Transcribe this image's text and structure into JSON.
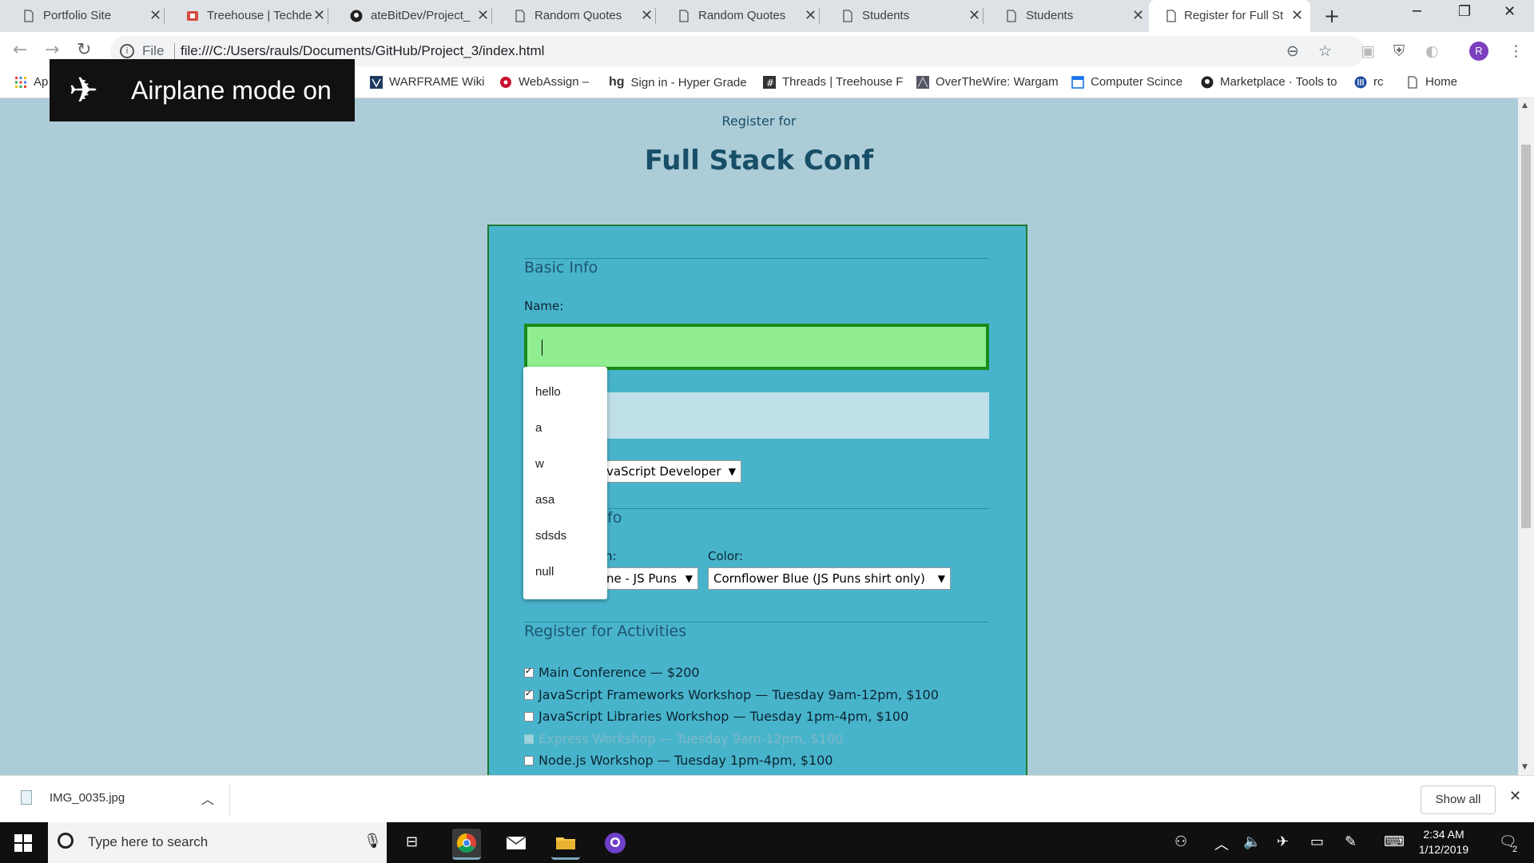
{
  "tabs": [
    {
      "label": "Portfolio Site",
      "icon": "page-icon"
    },
    {
      "label": "Treehouse | Techde",
      "icon": "treehouse-icon"
    },
    {
      "label": "ateBitDev/Project_",
      "icon": "github-icon"
    },
    {
      "label": "Random Quotes",
      "icon": "page-icon"
    },
    {
      "label": "Random Quotes",
      "icon": "page-icon"
    },
    {
      "label": "Students",
      "icon": "page-icon"
    },
    {
      "label": "Students",
      "icon": "page-icon"
    },
    {
      "label": "Register for Full St",
      "icon": "page-icon",
      "active": true
    }
  ],
  "toolbar": {
    "scheme_label": "File",
    "url": "file:///C:/Users/rauls/Documents/GitHub/Project_3/index.html",
    "avatar_letter": "R"
  },
  "bookmarks": [
    {
      "label": "Ap",
      "icon": "apps-icon"
    },
    {
      "label": "WARFRAME Wiki",
      "icon": "warframe-icon"
    },
    {
      "label": "WebAssign –",
      "icon": "webassign-icon"
    },
    {
      "label": "Sign in - Hyper Grade",
      "icon": "hypergrade-icon"
    },
    {
      "label": "Threads | Treehouse F",
      "icon": "threads-icon"
    },
    {
      "label": "OverTheWire: Wargam",
      "icon": "overthewire-icon"
    },
    {
      "label": "Computer Scince",
      "icon": "doc-icon"
    },
    {
      "label": "Marketplace · Tools to",
      "icon": "github-icon"
    },
    {
      "label": "rc",
      "icon": "rc-icon"
    },
    {
      "label": "Home",
      "icon": "page-icon"
    }
  ],
  "toast": {
    "text": "Airplane mode on",
    "icon": "airplane-icon"
  },
  "page": {
    "subheading": "Register for",
    "heading": "Full Stack Conf",
    "basic_info_legend": "Basic Info",
    "name_label": "Name:",
    "name_value": "",
    "job_role_value": "vaScript Developer",
    "tshirt_legend_partial": "fo",
    "design_label_partial": "n:",
    "design_value": "ne - JS Puns",
    "color_label": "Color:",
    "color_value": "Cornflower Blue (JS Puns shirt only)",
    "activities_legend": "Register for Activities",
    "activities": [
      {
        "label": "Main Conference — $200",
        "checked": true,
        "disabled": false
      },
      {
        "label": "JavaScript Frameworks Workshop — Tuesday 9am-12pm, $100",
        "checked": true,
        "disabled": false
      },
      {
        "label": "JavaScript Libraries Workshop — Tuesday 1pm-4pm, $100",
        "checked": false,
        "disabled": false
      },
      {
        "label": "Express Workshop — Tuesday 9am-12pm, $100",
        "checked": false,
        "disabled": true
      },
      {
        "label": "Node.js Workshop — Tuesday 1pm-4pm, $100",
        "checked": false,
        "disabled": false
      }
    ]
  },
  "autocomplete": [
    "hello",
    "a",
    "w",
    "asa",
    "sdsds",
    "null"
  ],
  "download": {
    "filename": "IMG_0035.jpg",
    "show_all": "Show all"
  },
  "taskbar": {
    "search_placeholder": "Type here to search",
    "time": "2:34 AM",
    "date": "1/12/2019",
    "notification_count": "2"
  },
  "colors": {
    "page_bg": "#acccd8",
    "form_bg": "#48b4cc",
    "name_field_bg": "#90ee90",
    "heading": "#184f68"
  }
}
